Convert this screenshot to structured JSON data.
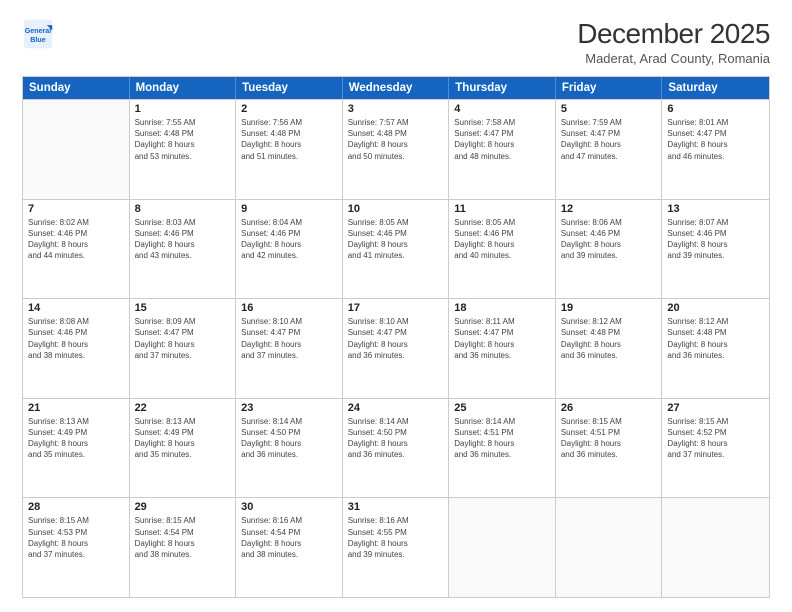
{
  "header": {
    "logo_line1": "General",
    "logo_line2": "Blue",
    "title": "December 2025",
    "subtitle": "Maderat, Arad County, Romania"
  },
  "weekdays": [
    "Sunday",
    "Monday",
    "Tuesday",
    "Wednesday",
    "Thursday",
    "Friday",
    "Saturday"
  ],
  "rows": [
    [
      {
        "day": "",
        "sunrise": "",
        "sunset": "",
        "daylight": ""
      },
      {
        "day": "1",
        "sunrise": "Sunrise: 7:55 AM",
        "sunset": "Sunset: 4:48 PM",
        "daylight": "Daylight: 8 hours",
        "daylight2": "and 53 minutes."
      },
      {
        "day": "2",
        "sunrise": "Sunrise: 7:56 AM",
        "sunset": "Sunset: 4:48 PM",
        "daylight": "Daylight: 8 hours",
        "daylight2": "and 51 minutes."
      },
      {
        "day": "3",
        "sunrise": "Sunrise: 7:57 AM",
        "sunset": "Sunset: 4:48 PM",
        "daylight": "Daylight: 8 hours",
        "daylight2": "and 50 minutes."
      },
      {
        "day": "4",
        "sunrise": "Sunrise: 7:58 AM",
        "sunset": "Sunset: 4:47 PM",
        "daylight": "Daylight: 8 hours",
        "daylight2": "and 48 minutes."
      },
      {
        "day": "5",
        "sunrise": "Sunrise: 7:59 AM",
        "sunset": "Sunset: 4:47 PM",
        "daylight": "Daylight: 8 hours",
        "daylight2": "and 47 minutes."
      },
      {
        "day": "6",
        "sunrise": "Sunrise: 8:01 AM",
        "sunset": "Sunset: 4:47 PM",
        "daylight": "Daylight: 8 hours",
        "daylight2": "and 46 minutes."
      }
    ],
    [
      {
        "day": "7",
        "sunrise": "Sunrise: 8:02 AM",
        "sunset": "Sunset: 4:46 PM",
        "daylight": "Daylight: 8 hours",
        "daylight2": "and 44 minutes."
      },
      {
        "day": "8",
        "sunrise": "Sunrise: 8:03 AM",
        "sunset": "Sunset: 4:46 PM",
        "daylight": "Daylight: 8 hours",
        "daylight2": "and 43 minutes."
      },
      {
        "day": "9",
        "sunrise": "Sunrise: 8:04 AM",
        "sunset": "Sunset: 4:46 PM",
        "daylight": "Daylight: 8 hours",
        "daylight2": "and 42 minutes."
      },
      {
        "day": "10",
        "sunrise": "Sunrise: 8:05 AM",
        "sunset": "Sunset: 4:46 PM",
        "daylight": "Daylight: 8 hours",
        "daylight2": "and 41 minutes."
      },
      {
        "day": "11",
        "sunrise": "Sunrise: 8:05 AM",
        "sunset": "Sunset: 4:46 PM",
        "daylight": "Daylight: 8 hours",
        "daylight2": "and 40 minutes."
      },
      {
        "day": "12",
        "sunrise": "Sunrise: 8:06 AM",
        "sunset": "Sunset: 4:46 PM",
        "daylight": "Daylight: 8 hours",
        "daylight2": "and 39 minutes."
      },
      {
        "day": "13",
        "sunrise": "Sunrise: 8:07 AM",
        "sunset": "Sunset: 4:46 PM",
        "daylight": "Daylight: 8 hours",
        "daylight2": "and 39 minutes."
      }
    ],
    [
      {
        "day": "14",
        "sunrise": "Sunrise: 8:08 AM",
        "sunset": "Sunset: 4:46 PM",
        "daylight": "Daylight: 8 hours",
        "daylight2": "and 38 minutes."
      },
      {
        "day": "15",
        "sunrise": "Sunrise: 8:09 AM",
        "sunset": "Sunset: 4:47 PM",
        "daylight": "Daylight: 8 hours",
        "daylight2": "and 37 minutes."
      },
      {
        "day": "16",
        "sunrise": "Sunrise: 8:10 AM",
        "sunset": "Sunset: 4:47 PM",
        "daylight": "Daylight: 8 hours",
        "daylight2": "and 37 minutes."
      },
      {
        "day": "17",
        "sunrise": "Sunrise: 8:10 AM",
        "sunset": "Sunset: 4:47 PM",
        "daylight": "Daylight: 8 hours",
        "daylight2": "and 36 minutes."
      },
      {
        "day": "18",
        "sunrise": "Sunrise: 8:11 AM",
        "sunset": "Sunset: 4:47 PM",
        "daylight": "Daylight: 8 hours",
        "daylight2": "and 36 minutes."
      },
      {
        "day": "19",
        "sunrise": "Sunrise: 8:12 AM",
        "sunset": "Sunset: 4:48 PM",
        "daylight": "Daylight: 8 hours",
        "daylight2": "and 36 minutes."
      },
      {
        "day": "20",
        "sunrise": "Sunrise: 8:12 AM",
        "sunset": "Sunset: 4:48 PM",
        "daylight": "Daylight: 8 hours",
        "daylight2": "and 36 minutes."
      }
    ],
    [
      {
        "day": "21",
        "sunrise": "Sunrise: 8:13 AM",
        "sunset": "Sunset: 4:49 PM",
        "daylight": "Daylight: 8 hours",
        "daylight2": "and 35 minutes."
      },
      {
        "day": "22",
        "sunrise": "Sunrise: 8:13 AM",
        "sunset": "Sunset: 4:49 PM",
        "daylight": "Daylight: 8 hours",
        "daylight2": "and 35 minutes."
      },
      {
        "day": "23",
        "sunrise": "Sunrise: 8:14 AM",
        "sunset": "Sunset: 4:50 PM",
        "daylight": "Daylight: 8 hours",
        "daylight2": "and 36 minutes."
      },
      {
        "day": "24",
        "sunrise": "Sunrise: 8:14 AM",
        "sunset": "Sunset: 4:50 PM",
        "daylight": "Daylight: 8 hours",
        "daylight2": "and 36 minutes."
      },
      {
        "day": "25",
        "sunrise": "Sunrise: 8:14 AM",
        "sunset": "Sunset: 4:51 PM",
        "daylight": "Daylight: 8 hours",
        "daylight2": "and 36 minutes."
      },
      {
        "day": "26",
        "sunrise": "Sunrise: 8:15 AM",
        "sunset": "Sunset: 4:51 PM",
        "daylight": "Daylight: 8 hours",
        "daylight2": "and 36 minutes."
      },
      {
        "day": "27",
        "sunrise": "Sunrise: 8:15 AM",
        "sunset": "Sunset: 4:52 PM",
        "daylight": "Daylight: 8 hours",
        "daylight2": "and 37 minutes."
      }
    ],
    [
      {
        "day": "28",
        "sunrise": "Sunrise: 8:15 AM",
        "sunset": "Sunset: 4:53 PM",
        "daylight": "Daylight: 8 hours",
        "daylight2": "and 37 minutes."
      },
      {
        "day": "29",
        "sunrise": "Sunrise: 8:15 AM",
        "sunset": "Sunset: 4:54 PM",
        "daylight": "Daylight: 8 hours",
        "daylight2": "and 38 minutes."
      },
      {
        "day": "30",
        "sunrise": "Sunrise: 8:16 AM",
        "sunset": "Sunset: 4:54 PM",
        "daylight": "Daylight: 8 hours",
        "daylight2": "and 38 minutes."
      },
      {
        "day": "31",
        "sunrise": "Sunrise: 8:16 AM",
        "sunset": "Sunset: 4:55 PM",
        "daylight": "Daylight: 8 hours",
        "daylight2": "and 39 minutes."
      },
      {
        "day": "",
        "sunrise": "",
        "sunset": "",
        "daylight": "",
        "daylight2": ""
      },
      {
        "day": "",
        "sunrise": "",
        "sunset": "",
        "daylight": "",
        "daylight2": ""
      },
      {
        "day": "",
        "sunrise": "",
        "sunset": "",
        "daylight": "",
        "daylight2": ""
      }
    ]
  ]
}
